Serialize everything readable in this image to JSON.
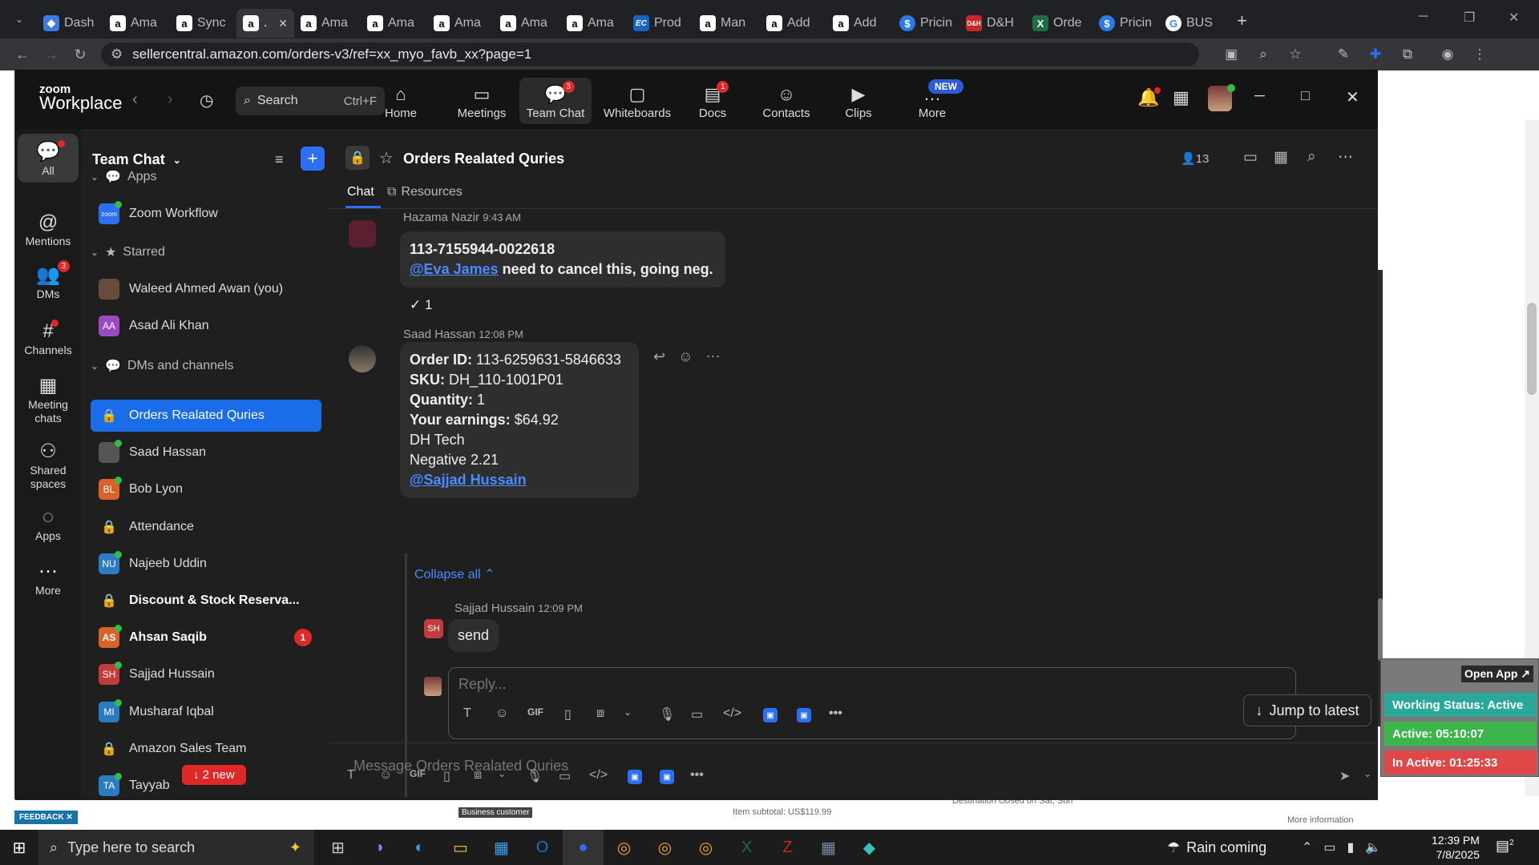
{
  "browser": {
    "tabs": [
      {
        "title": "Dash",
        "icon": "blue-diamond-icon",
        "favclass": "blue",
        "glyph": "◆"
      },
      {
        "title": "Ama",
        "icon": "amazon-icon",
        "favclass": "amazon",
        "glyph": "a"
      },
      {
        "title": "Sync",
        "icon": "amazon-icon",
        "favclass": "amazon",
        "glyph": "a"
      },
      {
        "title": ".",
        "icon": "amazon-icon",
        "favclass": "amazon",
        "glyph": "a",
        "active": true
      },
      {
        "title": "Ama",
        "icon": "amazon-icon",
        "favclass": "amazon",
        "glyph": "a"
      },
      {
        "title": "Ama",
        "icon": "amazon-icon",
        "favclass": "amazon",
        "glyph": "a"
      },
      {
        "title": "Ama",
        "icon": "amazon-icon",
        "favclass": "amazon",
        "glyph": "a"
      },
      {
        "title": "Ama",
        "icon": "amazon-icon",
        "favclass": "amazon",
        "glyph": "a"
      },
      {
        "title": "Ama",
        "icon": "amazon-icon",
        "favclass": "amazon",
        "glyph": "a"
      },
      {
        "title": "Prod",
        "icon": "ec-icon",
        "favclass": "ec",
        "glyph": "EC"
      },
      {
        "title": "Man",
        "icon": "amazon-icon",
        "favclass": "amazon",
        "glyph": "a"
      },
      {
        "title": "Add",
        "icon": "amazon-icon",
        "favclass": "amazon",
        "glyph": "a"
      },
      {
        "title": "Add",
        "icon": "amazon-icon",
        "favclass": "amazon",
        "glyph": "a"
      },
      {
        "title": "Pricin",
        "icon": "dollar-icon",
        "favclass": "s",
        "glyph": "$"
      },
      {
        "title": "D&H",
        "icon": "dh-icon",
        "favclass": "dh",
        "glyph": "D&H"
      },
      {
        "title": "Orde",
        "icon": "excel-icon",
        "favclass": "xl",
        "glyph": "X"
      },
      {
        "title": "Pricin",
        "icon": "dollar-icon",
        "favclass": "s",
        "glyph": "$"
      },
      {
        "title": "BUS",
        "icon": "google-icon",
        "favclass": "g",
        "glyph": "G"
      }
    ],
    "url": "sellercentral.amazon.com/orders-v3/ref=xx_myo_favb_xx?page=1",
    "page_strip": {
      "text1": "Business customer",
      "text2": "Item subtotal: US$119.99",
      "text3": "Destination closed on Sat, Sun",
      "text4": "More information",
      "feedback": "FEEDBACK"
    }
  },
  "zoom": {
    "logo_line1": "zoom",
    "logo_line2": "Workplace",
    "search_label": "Search",
    "search_shortcut": "Ctrl+F",
    "nav": [
      {
        "label": "Home",
        "icon": "home-icon",
        "glyph": "⌂"
      },
      {
        "label": "Meetings",
        "icon": "video-camera-icon",
        "glyph": "▭"
      },
      {
        "label": "Team Chat",
        "icon": "chat-bubble-icon",
        "glyph": "💬",
        "badge": "3",
        "active": true
      },
      {
        "label": "Whiteboards",
        "icon": "whiteboard-icon",
        "glyph": "▢"
      },
      {
        "label": "Docs",
        "icon": "document-icon",
        "glyph": "▤",
        "badge": "1"
      },
      {
        "label": "Contacts",
        "icon": "contacts-icon",
        "glyph": "☺"
      },
      {
        "label": "Clips",
        "icon": "clips-icon",
        "glyph": "▶"
      },
      {
        "label": "More",
        "icon": "more-dots-icon",
        "glyph": "…",
        "new": "NEW"
      }
    ],
    "rail": [
      {
        "label": "All",
        "icon": "chat-bubble-icon",
        "glyph": "💬",
        "active": true,
        "dot": true
      },
      {
        "label": "Mentions",
        "icon": "at-sign-icon",
        "glyph": "@"
      },
      {
        "label": "DMs",
        "icon": "people-icon",
        "glyph": "👥",
        "badge": "3"
      },
      {
        "label": "Channels",
        "icon": "hashtag-icon",
        "glyph": "#",
        "dot": true
      },
      {
        "label": "Meeting chats",
        "icon": "calendar-icon",
        "glyph": "▦"
      },
      {
        "label": "Shared spaces",
        "icon": "shared-spaces-icon",
        "glyph": "⚇"
      },
      {
        "label": "Apps",
        "icon": "apps-icon",
        "glyph": "◌"
      },
      {
        "label": "More",
        "icon": "more-dots-icon",
        "glyph": "⋯"
      }
    ],
    "sidebar": {
      "title": "Team Chat",
      "sections": {
        "apps": "Apps",
        "starred": "Starred",
        "dms": "DMs and channels"
      },
      "app_item": "Zoom Workflow",
      "starred_items": [
        {
          "label": "Waleed Ahmed Awan (you)",
          "initials": "",
          "color": "#6a4a3a"
        },
        {
          "label": "Asad Ali Khan",
          "initials": "AA",
          "color": "#9b4bc2"
        }
      ],
      "items": [
        {
          "label": "Orders Realated Quries",
          "type": "lock",
          "active": true
        },
        {
          "label": "Saad Hassan",
          "type": "avatar",
          "initials": "",
          "color": "#555"
        },
        {
          "label": "Bob Lyon",
          "type": "avatar",
          "initials": "BL",
          "color": "#d9622b"
        },
        {
          "label": "Attendance",
          "type": "lock"
        },
        {
          "label": "Najeeb Uddin",
          "type": "avatar",
          "initials": "NU",
          "color": "#2b7bc4"
        },
        {
          "label": "Discount & Stock Reserva...",
          "type": "lock",
          "bold": true
        },
        {
          "label": "Ahsan Saqib",
          "type": "avatar",
          "initials": "AS",
          "color": "#d9622b",
          "bold": true,
          "count": "1"
        },
        {
          "label": "Sajjad Hussain",
          "type": "avatar",
          "initials": "SH",
          "color": "#c43b3b"
        },
        {
          "label": "Musharaf Iqbal",
          "type": "avatar",
          "initials": "MI",
          "color": "#2b7bc4"
        },
        {
          "label": "Amazon Sales Team",
          "type": "lock"
        },
        {
          "label": "Tayyab",
          "type": "avatar",
          "initials": "TA",
          "color": "#2b7bc4"
        }
      ],
      "new_pill": "↓ 2 new"
    },
    "channel": {
      "title": "Orders Realated Quries",
      "members": "13",
      "tab_chat": "Chat",
      "tab_resources": "Resources"
    },
    "messages": {
      "m1_author": "Hazama Nazir",
      "m1_time": "9:43 AM",
      "m1_line1": "113-7155944-0022618",
      "m1_mention": "@Eva James",
      "m1_text": " need to cancel this, going neg.",
      "m1_reaction": "✓ 1",
      "m2_author": "Saad Hassan",
      "m2_time": "12:08 PM",
      "m2_order_label": "Order ID:",
      "m2_order_value": " 113-6259631-5846633",
      "m2_sku_label": "SKU:",
      "m2_sku_value": " DH_110-1001P01",
      "m2_qty_label": "Quantity:",
      "m2_qty_value": " 1",
      "m2_earn_label": "Your earnings:",
      "m2_earn_value": " $64.92",
      "m2_line5": "DH Tech",
      "m2_line6": "Negative 2.21",
      "m2_mention": "@Sajjad Hussain",
      "collapse_all": "Collapse all ⌃",
      "m3_author": "Sajjad Hussain",
      "m3_time": "12:09 PM",
      "m3_initials": "SH",
      "m3_text": "send"
    },
    "reply": {
      "placeholder": "Reply...",
      "jump_latest": "Jump to latest"
    },
    "composer": {
      "placeholder": "Message Orders Realated Quries"
    }
  },
  "work_status": {
    "open_app": "Open App ↗",
    "status": "Working Status: Active",
    "active": "Active: 05:10:07",
    "inactive": "In Active: 01:25:33",
    "colors": {
      "status": "#2aa89a",
      "active": "#3cb54a",
      "inactive": "#e04848"
    }
  },
  "taskbar": {
    "search_placeholder": "Type here to search",
    "weather": "Rain coming",
    "time": "12:39 PM",
    "date": "7/8/2025",
    "notifications": "2",
    "apps": [
      {
        "name": "task-view-icon",
        "glyph": "⊞"
      },
      {
        "name": "copilot-icon",
        "glyph": "◑"
      },
      {
        "name": "edge-icon",
        "glyph": "◐"
      },
      {
        "name": "file-explorer-icon",
        "glyph": "▭"
      },
      {
        "name": "store-icon",
        "glyph": "▦"
      },
      {
        "name": "outlook-icon",
        "glyph": "O"
      },
      {
        "name": "zoom-app-icon",
        "glyph": "●",
        "active": true
      },
      {
        "name": "chrome-icon",
        "glyph": "◎"
      },
      {
        "name": "chrome-icon-2",
        "glyph": "◎"
      },
      {
        "name": "chrome-icon-3",
        "glyph": "◎"
      },
      {
        "name": "excel-icon",
        "glyph": "X"
      },
      {
        "name": "filezilla-icon",
        "glyph": "Z"
      },
      {
        "name": "calculator-icon",
        "glyph": "▦"
      },
      {
        "name": "app-icon",
        "glyph": "◆"
      }
    ]
  }
}
